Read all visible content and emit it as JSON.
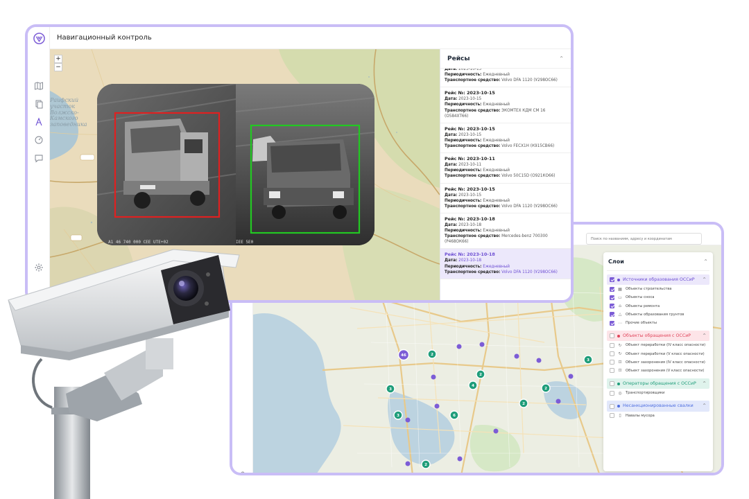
{
  "app": {
    "title": "Навигационный контроль"
  },
  "trips_panel": {
    "title": "Рейсы",
    "date_label": "Дата:",
    "period_label": "Периодичность:",
    "vehicle_label": "Транспортное средство:",
    "cut_top": "Рейс №: 2023-10-15",
    "items": [
      {
        "title": "",
        "date": "2023-10-15",
        "period": "Ежедневный",
        "vehicle": "Volvo DFA 1120 (У298ОС66)",
        "cut": true
      },
      {
        "title": "Рейс №: 2023-10-15",
        "date": "2023-10-15",
        "period": "Ежедневный",
        "vehicle": "ЭКОМТЕХ КДМ СМ 16 (О584ХТ66)"
      },
      {
        "title": "Рейс №: 2023-10-15",
        "date": "2023-10-15",
        "period": "Ежедневный",
        "vehicle": "Volvo FECX1H (К915СВ66)"
      },
      {
        "title": "Рейс №: 2023-10-11",
        "date": "2023-10-11",
        "period": "Ежедневный",
        "vehicle": "Volvo 50C15D (О921КО66)"
      },
      {
        "title": "Рейс №: 2023-10-15",
        "date": "2023-10-15",
        "period": "Ежедневный",
        "vehicle": "Volvo DFA 1120 (У298ОС66)"
      },
      {
        "title": "Рейс №: 2023-10-18",
        "date": "2023-10-18",
        "period": "Ежедневный",
        "vehicle": "Mercedes-benz 700300 (Р468ОК66)"
      },
      {
        "title": "Рейс №: 2023-10-18",
        "date": "2023-10-18",
        "period": "Ежедневный",
        "vehicle": "Volvo DFA 1120 (У298ОС66)",
        "selected": true
      }
    ]
  },
  "map1": {
    "zoom_in": "+",
    "zoom_out": "−",
    "labels": {
      "reserve": "Раифский\nучасток\nВолжско-\nКамского\nзаповедника"
    }
  },
  "camera_overlay": {
    "left": "A1 46 740 000 CEE UTE+02",
    "right": "IEE 5E0"
  },
  "win2": {
    "search_placeholder": "Поиск по названиям, адресу и координатам",
    "layers": {
      "title": "Слои",
      "groups": [
        {
          "title": "Источники образования ОССиР",
          "color": "#6d4fd3",
          "bg": "#ece8fb",
          "checked": true,
          "items": [
            {
              "label": "Объекты строительства",
              "icon": "building-icon",
              "glyph": "▦",
              "checked": true
            },
            {
              "label": "Объекты сноса",
              "icon": "demolition-icon",
              "glyph": "▭",
              "checked": true
            },
            {
              "label": "Объекты ремонта",
              "icon": "repair-icon",
              "glyph": "⌂",
              "checked": true
            },
            {
              "label": "Объекты образования грунтов",
              "icon": "soil-icon",
              "glyph": "△",
              "checked": true
            },
            {
              "label": "Прочие объекты",
              "icon": "dots-icon",
              "glyph": "⋯",
              "checked": true
            }
          ]
        },
        {
          "title": "Объекты обращения с ОССиР",
          "color": "#e0455b",
          "bg": "#fde4e8",
          "checked": false,
          "items": [
            {
              "label": "Объект переработки (IV класс опасности)",
              "icon": "recycle-icon",
              "glyph": "↻",
              "checked": false
            },
            {
              "label": "Объект переработки (V класс опасности)",
              "icon": "recycle-icon",
              "glyph": "↻",
              "checked": false
            },
            {
              "label": "Объект захоронения (IV класс опасности)",
              "icon": "burial-icon",
              "glyph": "⊡",
              "checked": false
            },
            {
              "label": "Объект захоронения (V класс опасности)",
              "icon": "burial-icon",
              "glyph": "⊡",
              "checked": false
            }
          ]
        },
        {
          "title": "Операторы обращения с ОССиР",
          "color": "#1f9d7a",
          "bg": "#dff3ec",
          "checked": false,
          "items": [
            {
              "label": "Транспортировщики",
              "icon": "truck-icon",
              "glyph": "◎",
              "checked": false
            }
          ]
        },
        {
          "title": "Несанкционированные свалки",
          "color": "#4f6fe0",
          "bg": "#e2e8fb",
          "checked": false,
          "items": [
            {
              "label": "Навалы мусора",
              "icon": "trash-icon",
              "glyph": "▯",
              "checked": false
            }
          ]
        }
      ]
    },
    "clusters": [
      {
        "label": "46",
        "color": "#7c5cd6"
      },
      {
        "label": "2",
        "color": "#1f9d7a"
      },
      {
        "label": "3",
        "color": "#1f9d7a"
      },
      {
        "label": "4",
        "color": "#1f9d7a"
      },
      {
        "label": "2",
        "color": "#1f9d7a"
      },
      {
        "label": "3",
        "color": "#1f9d7a"
      },
      {
        "label": "6",
        "color": "#1f9d7a"
      },
      {
        "label": "2",
        "color": "#1f9d7a"
      },
      {
        "label": "2",
        "color": "#1f9d7a"
      },
      {
        "label": "3",
        "color": "#1f9d7a"
      },
      {
        "label": "2",
        "color": "#1f9d7a"
      },
      {
        "label": "2",
        "color": "#1f9d7a"
      }
    ]
  }
}
